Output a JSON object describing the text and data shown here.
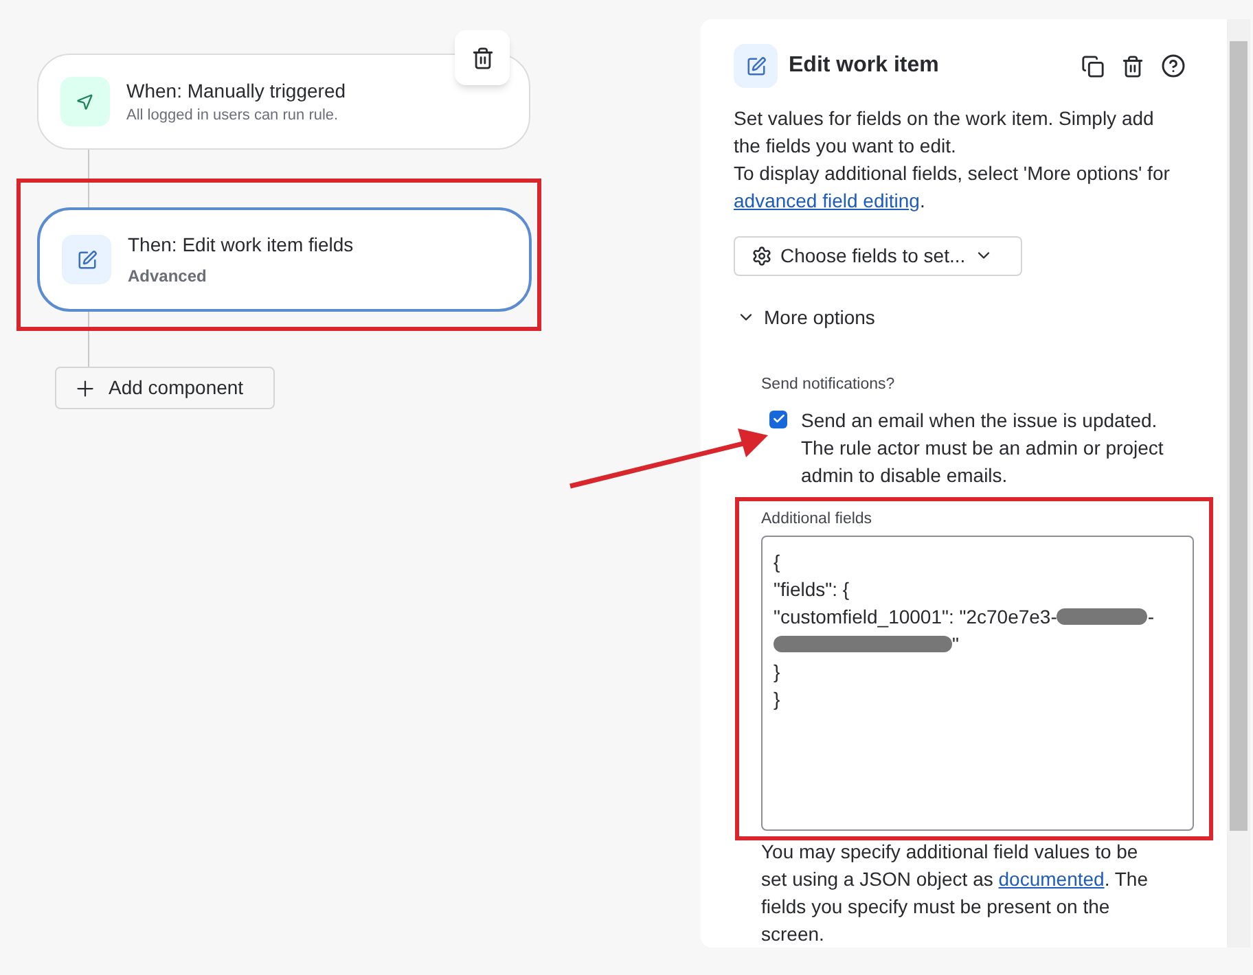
{
  "canvas": {
    "trigger": {
      "title": "When: Manually triggered",
      "subtitle": "All logged in users can run rule."
    },
    "action": {
      "title": "Then: Edit work item fields",
      "subtitle": "Advanced",
      "selected": true
    },
    "add_button": "Add component"
  },
  "panel": {
    "title": "Edit work item",
    "description": "Set values for fields on the work item. Simply add the fields you want to edit.",
    "description_2": "To display additional fields, select 'More options' for ",
    "description_link": "advanced field editing",
    "description_end": ".",
    "choose_fields": "Choose fields to set...",
    "more_options": {
      "label": "More options",
      "expanded": true
    },
    "notifications": {
      "label": "Send notifications?",
      "checked": true,
      "text": "Send an email when the issue is updated. The rule actor must be an admin or project admin to disable emails."
    },
    "additional_fields": {
      "label": "Additional fields",
      "lines": [
        [
          {
            "kind": "text",
            "text": "{"
          }
        ],
        [
          {
            "kind": "text",
            "text": "\"fields\": {"
          }
        ],
        [
          {
            "kind": "text",
            "text": "\"customfield_10001\": \"2c70e7e3-"
          },
          {
            "kind": "redaction"
          },
          {
            "kind": "text",
            "text": "-"
          }
        ],
        [
          {
            "kind": "redaction"
          },
          {
            "kind": "text",
            "text": "\""
          }
        ],
        [
          {
            "kind": "text",
            "text": "}"
          }
        ],
        [
          {
            "kind": "text",
            "text": "}"
          }
        ]
      ]
    },
    "help": "You may specify additional field values to be set using a JSON object as ",
    "help_link": "documented",
    "help_end": ". The fields you specify must be present on the screen."
  }
}
